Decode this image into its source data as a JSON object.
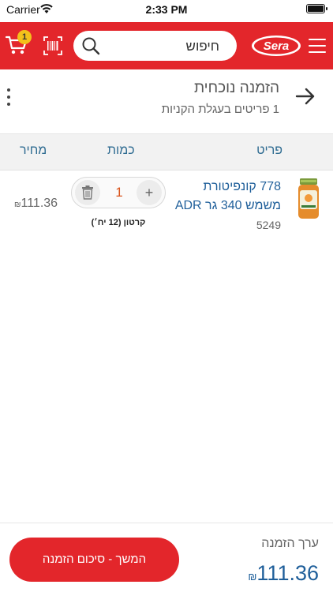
{
  "status_bar": {
    "carrier": "Carrier",
    "time": "2:33 PM"
  },
  "header": {
    "cart_count": "1",
    "search_placeholder": "חיפוש",
    "logo_text": "Sera",
    "colors": {
      "brand": "#e3262b",
      "badge": "#f3c11b"
    }
  },
  "order": {
    "title": "הזמנה נוכחית",
    "subtitle": "1 פריטים בעגלת הקניות"
  },
  "table": {
    "headers": {
      "item": "פריט",
      "qty": "כמות",
      "price": "מחיר"
    },
    "rows": [
      {
        "name": "778 קונפיטורת משמש 340 גר ADR",
        "code": "5249",
        "quantity": "1",
        "pack": "קרטון (12 יח׳)",
        "price": "111.36",
        "currency": "₪"
      }
    ]
  },
  "footer": {
    "total_label": "ערך הזמנה",
    "total_value": "111.36",
    "currency": "₪",
    "continue_label": "המשך - סיכום הזמנה"
  }
}
